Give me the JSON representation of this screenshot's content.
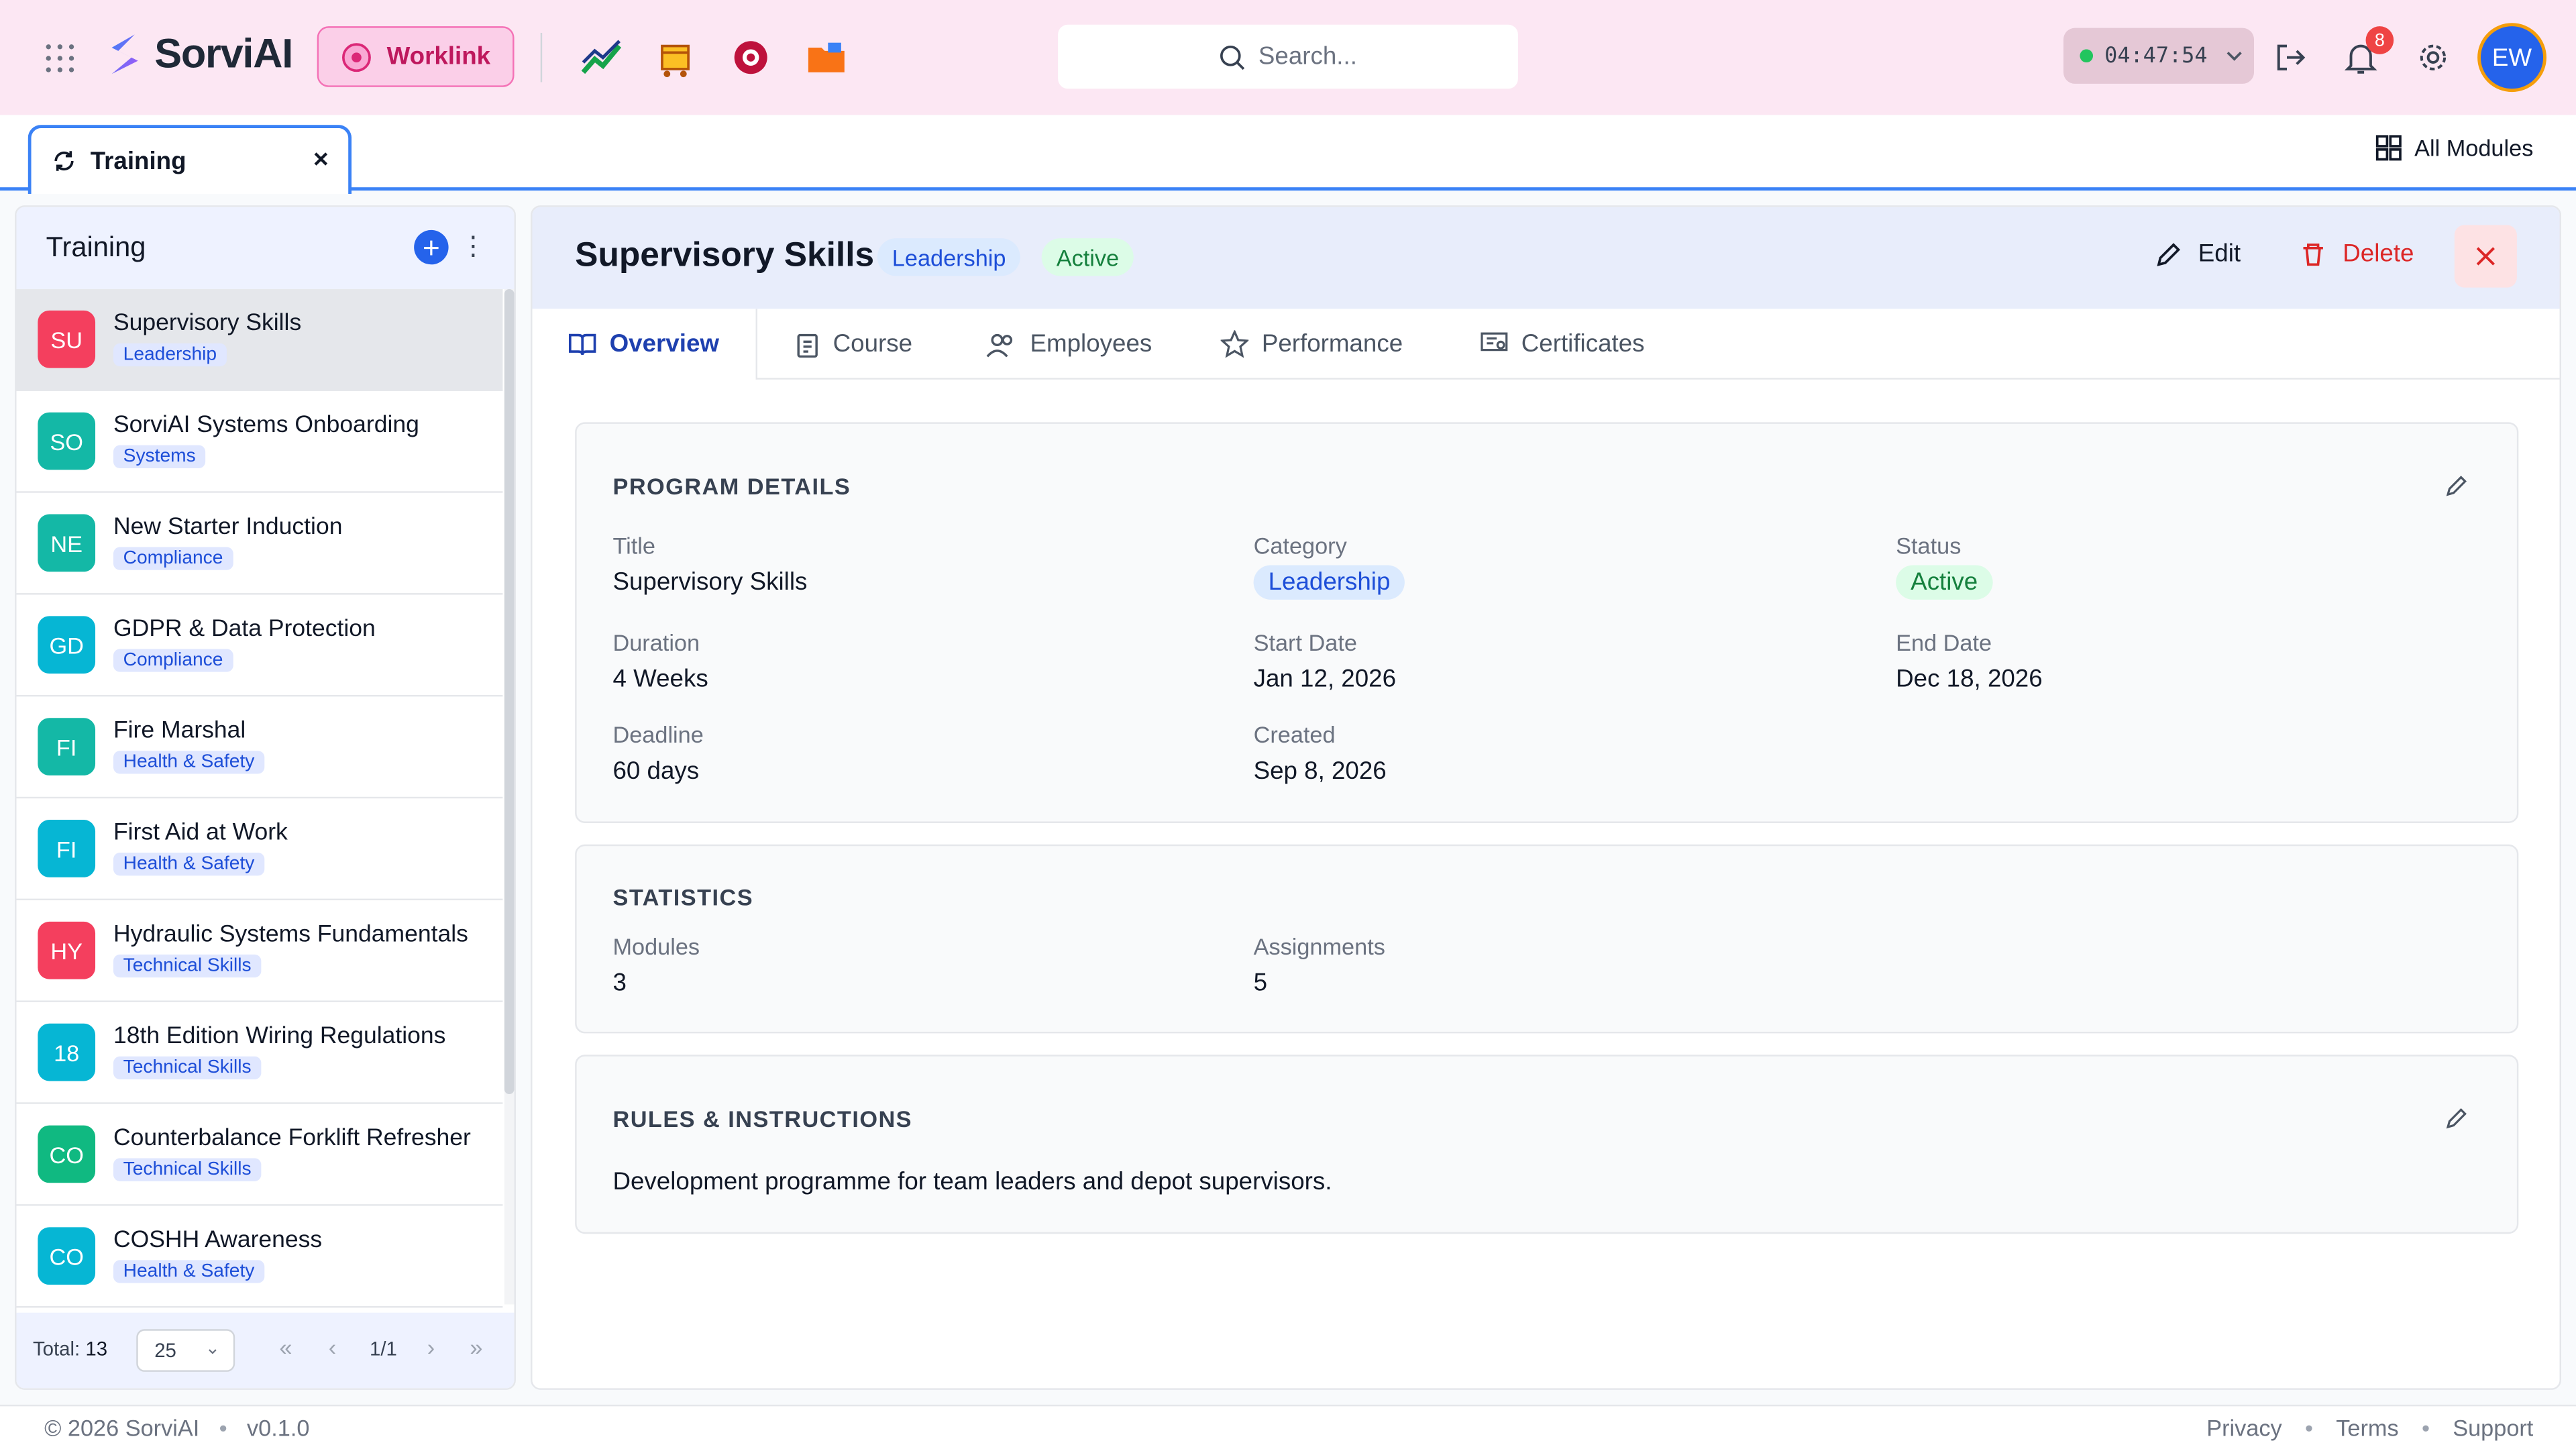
{
  "header": {
    "logo_text": "SorviAI",
    "worklink_label": "Worklink",
    "search_placeholder": "Search...",
    "timer": "04:47:54",
    "notification_count": "8",
    "avatar_initials": "EW"
  },
  "tabstrip": {
    "active_tab": "Training",
    "all_modules": "All Modules"
  },
  "sidebar": {
    "title": "Training",
    "items": [
      {
        "initials": "SU",
        "title": "Supervisory Skills",
        "tag": "Leadership",
        "color": "#f43f5e"
      },
      {
        "initials": "SO",
        "title": "SorviAI Systems Onboarding",
        "tag": "Systems",
        "color": "#14b8a6"
      },
      {
        "initials": "NE",
        "title": "New Starter Induction",
        "tag": "Compliance",
        "color": "#14b8a6"
      },
      {
        "initials": "GD",
        "title": "GDPR & Data Protection",
        "tag": "Compliance",
        "color": "#06b6d4"
      },
      {
        "initials": "FI",
        "title": "Fire Marshal",
        "tag": "Health & Safety",
        "color": "#14b8a6"
      },
      {
        "initials": "FI",
        "title": "First Aid at Work",
        "tag": "Health & Safety",
        "color": "#06b6d4"
      },
      {
        "initials": "HY",
        "title": "Hydraulic Systems Fundamentals",
        "tag": "Technical Skills",
        "color": "#f43f5e"
      },
      {
        "initials": "18",
        "title": "18th Edition Wiring Regulations",
        "tag": "Technical Skills",
        "color": "#06b6d4"
      },
      {
        "initials": "CO",
        "title": "Counterbalance Forklift Refresher",
        "tag": "Technical Skills",
        "color": "#10b981"
      },
      {
        "initials": "CO",
        "title": "COSHH Awareness",
        "tag": "Health & Safety",
        "color": "#06b6d4"
      }
    ],
    "footer": {
      "total_label": "Total:",
      "total_value": "13",
      "page_size": "25",
      "page": "1/1"
    }
  },
  "detail": {
    "title": "Supervisory Skills",
    "category_pill": "Leadership",
    "status_pill": "Active",
    "edit_label": "Edit",
    "delete_label": "Delete",
    "tabs": [
      "Overview",
      "Course",
      "Employees",
      "Performance",
      "Certificates"
    ],
    "program": {
      "heading": "PROGRAM DETAILS",
      "fields": [
        {
          "label": "Title",
          "value": "Supervisory Skills"
        },
        {
          "label": "Category",
          "value": "Leadership"
        },
        {
          "label": "Status",
          "value": "Active"
        },
        {
          "label": "Duration",
          "value": "4 Weeks"
        },
        {
          "label": "Start Date",
          "value": "Jan 12, 2026"
        },
        {
          "label": "End Date",
          "value": "Dec 18, 2026"
        },
        {
          "label": "Deadline",
          "value": "60 days"
        },
        {
          "label": "Created",
          "value": "Sep 8, 2026"
        }
      ]
    },
    "statistics": {
      "heading": "STATISTICS",
      "fields": [
        {
          "label": "Modules",
          "value": "3"
        },
        {
          "label": "Assignments",
          "value": "5"
        }
      ]
    },
    "rules": {
      "heading": "RULES & INSTRUCTIONS",
      "text": "Development programme for team leaders and depot supervisors."
    }
  },
  "footer": {
    "copyright": "© 2026 SorviAI",
    "version": "v0.1.0",
    "links": [
      "Privacy",
      "Terms",
      "Support"
    ]
  }
}
